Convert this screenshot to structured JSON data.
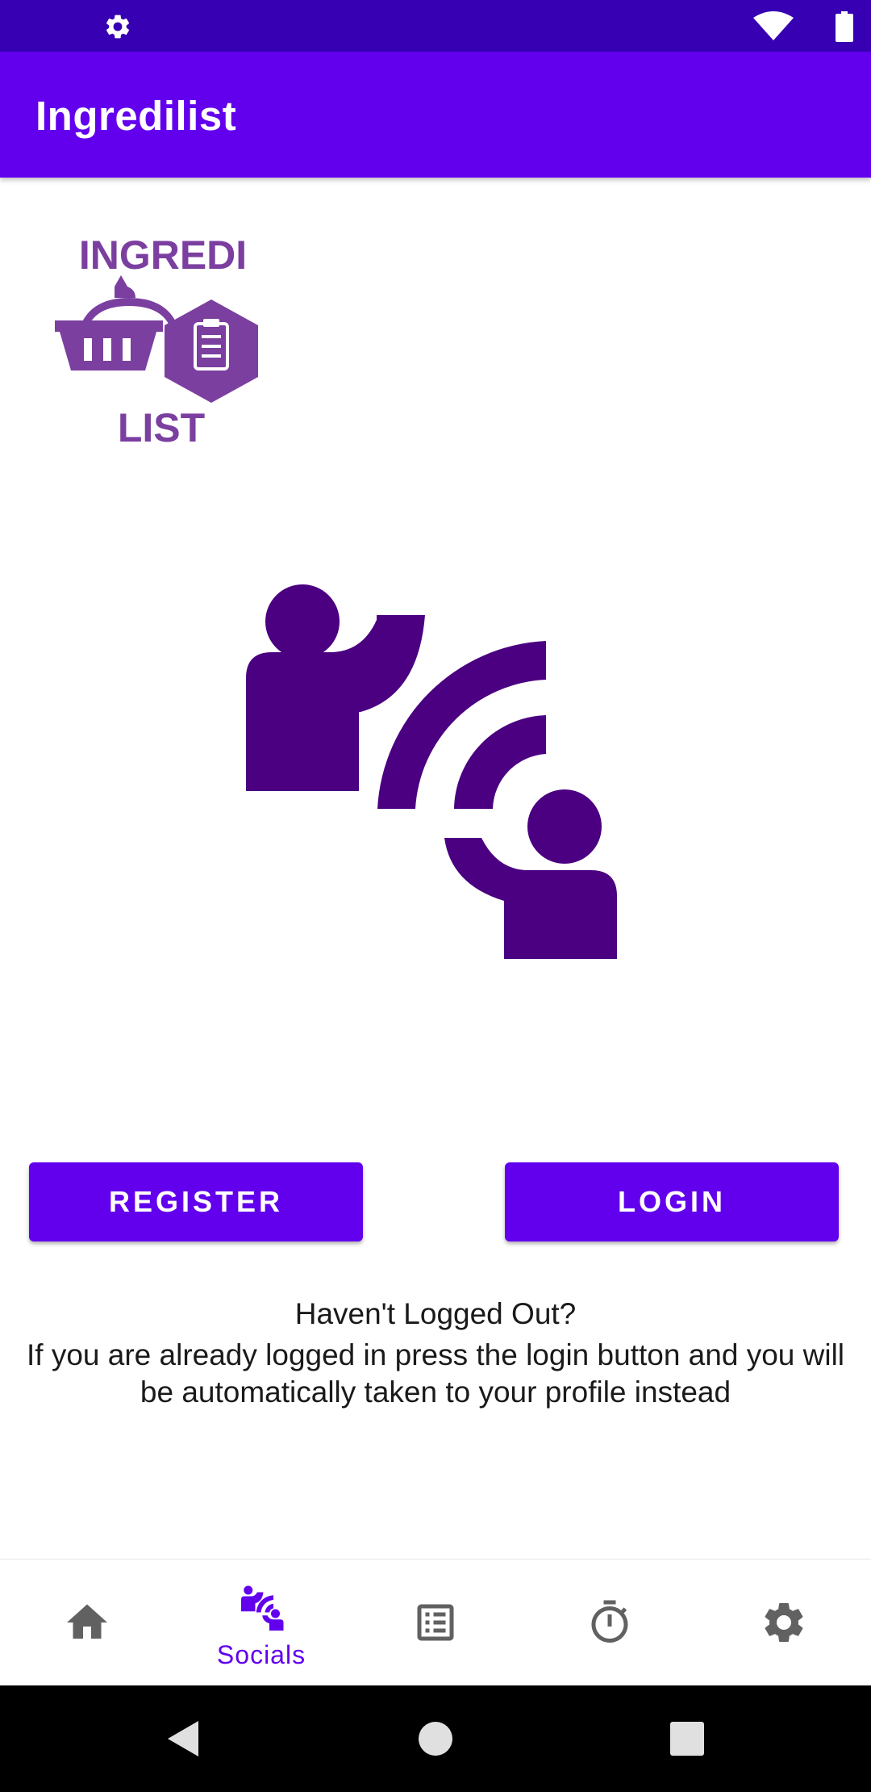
{
  "status_bar": {
    "icons": [
      "gear-icon",
      "wifi-icon",
      "battery-icon"
    ],
    "background": "#3700b3"
  },
  "app_bar": {
    "title": "Ingredilist",
    "background": "#6200ee"
  },
  "logo": {
    "text_top": "INGREDI",
    "text_bottom": "LIST",
    "color": "#7b3fa0"
  },
  "hero": {
    "icon": "connect-people-icon",
    "color": "#4a0080"
  },
  "actions": {
    "register_label": "REGISTER",
    "login_label": "LOGIN"
  },
  "info": {
    "title": "Haven't Logged Out?",
    "body": "If you are already logged in press the login button and you will be automatically taken to your profile instead"
  },
  "bottom_nav": {
    "items": [
      {
        "icon": "home-icon",
        "label": "",
        "active": false
      },
      {
        "icon": "socials-icon",
        "label": "Socials",
        "active": true
      },
      {
        "icon": "list-icon",
        "label": "",
        "active": false
      },
      {
        "icon": "timer-icon",
        "label": "",
        "active": false
      },
      {
        "icon": "settings-icon",
        "label": "",
        "active": false
      }
    ],
    "active_color": "#6200ee",
    "inactive_color": "#616161"
  },
  "system_nav": {
    "icons": [
      "back-icon",
      "home-circle-icon",
      "recents-icon"
    ]
  }
}
